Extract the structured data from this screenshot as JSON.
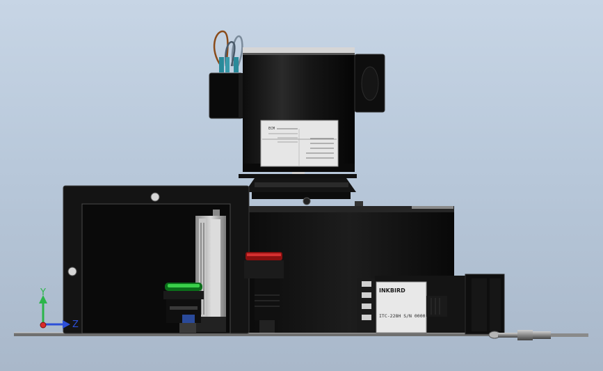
{
  "motor_label": {
    "left_lines": [
      "ECM",
      "",
      "",
      ""
    ],
    "right_lines": [
      "",
      "",
      "",
      ""
    ]
  },
  "controller": {
    "brand": "INKBIRD",
    "model": "ITC-228H S/N 0000"
  },
  "triad": {
    "y_label": "Y",
    "z_label": "Z",
    "colors": {
      "y": "#2bb54a",
      "z": "#2c4fd8",
      "x": "#d92b2b"
    }
  }
}
